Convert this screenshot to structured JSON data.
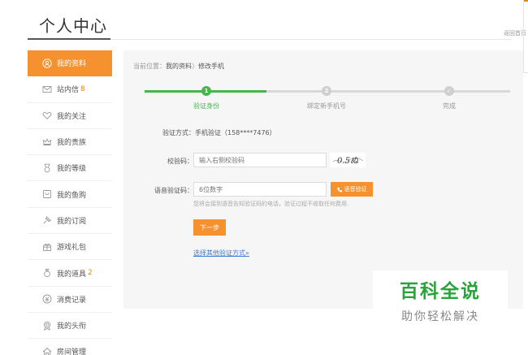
{
  "header": {
    "title": "个人中心",
    "return_home": "返回首页"
  },
  "sidebar": {
    "items": [
      {
        "label": "我的资料",
        "icon": "user-icon",
        "active": true,
        "count": ""
      },
      {
        "label": "站内信",
        "icon": "mail-icon",
        "active": false,
        "count": "8"
      },
      {
        "label": "我的关注",
        "icon": "heart-icon",
        "active": false,
        "count": ""
      },
      {
        "label": "我的贵族",
        "icon": "crown-icon",
        "active": false,
        "count": ""
      },
      {
        "label": "我的等级",
        "icon": "medal-icon",
        "active": false,
        "count": ""
      },
      {
        "label": "我的鱼购",
        "icon": "cart-icon",
        "active": false,
        "count": ""
      },
      {
        "label": "我的订阅",
        "icon": "subscribe-icon",
        "active": false,
        "count": ""
      },
      {
        "label": "游戏礼包",
        "icon": "gift-icon",
        "active": false,
        "count": ""
      },
      {
        "label": "我的道具",
        "icon": "item-bag-icon",
        "active": false,
        "count": "2"
      },
      {
        "label": "消费记录",
        "icon": "coin-icon",
        "active": false,
        "count": ""
      },
      {
        "label": "我的头衔",
        "icon": "title-badge-icon",
        "active": false,
        "count": ""
      },
      {
        "label": "房间管理",
        "icon": "house-icon",
        "active": false,
        "count": ""
      }
    ]
  },
  "breadcrumb": {
    "prefix": "当前位置：",
    "parent": "我的资料",
    "separator": "〉",
    "current": "修改手机"
  },
  "steps": [
    {
      "number": "1",
      "label": "验证身份",
      "state": "current"
    },
    {
      "number": "2",
      "label": "绑定新手机号",
      "state": "pending"
    },
    {
      "number": "✓",
      "label": "完成",
      "state": "pending"
    }
  ],
  "form": {
    "method_text": "验证方式：手机验证（158****7476）",
    "captcha_label": "校验码：",
    "captcha_placeholder": "输入右侧校验码",
    "captcha_text": "0.5ぬ",
    "voice_label": "语音验证码：",
    "voice_placeholder": "6位数字",
    "voice_button": "语音验证",
    "hint": "您将会接到语音告知验证码的电话，验证过程不收取任何费用.",
    "next_button": "下一步",
    "other_method_link": "选择其他验证方式»"
  },
  "watermark": {
    "main": "百科全说",
    "sub": "助你轻松解决"
  },
  "colors": {
    "accent": "#f5922f",
    "step_done": "#46b64a",
    "link": "#3a7fd5",
    "watermark_green": "#2aa33a"
  }
}
